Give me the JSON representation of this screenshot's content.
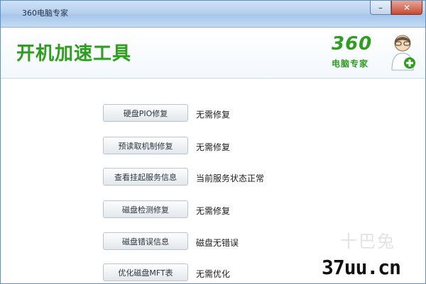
{
  "window": {
    "title": "360电脑专家",
    "minimize_symbol": "–",
    "close_symbol": "✕"
  },
  "header": {
    "title": "开机加速工具",
    "logo_text": "360",
    "logo_subtext": "电脑专家"
  },
  "rows": [
    {
      "button": "硬盘PIO修复",
      "status": "无需修复"
    },
    {
      "button": "预读取机制修复",
      "status": "无需修复"
    },
    {
      "button": "查看挂起服务信息",
      "status": "当前服务状态正常"
    },
    {
      "button": "磁盘检测修复",
      "status": "无需修复"
    },
    {
      "button": "磁盘错误信息",
      "status": "磁盘无错误"
    },
    {
      "button": "优化磁盘MFT表",
      "status": "无需优化"
    }
  ],
  "watermark": {
    "text": "十巴兔",
    "url": "37uu.cn"
  },
  "colors": {
    "accent_green": "#2f9d1f",
    "titlebar_blue": "#b7d1ee",
    "close_red": "#c64a33"
  }
}
